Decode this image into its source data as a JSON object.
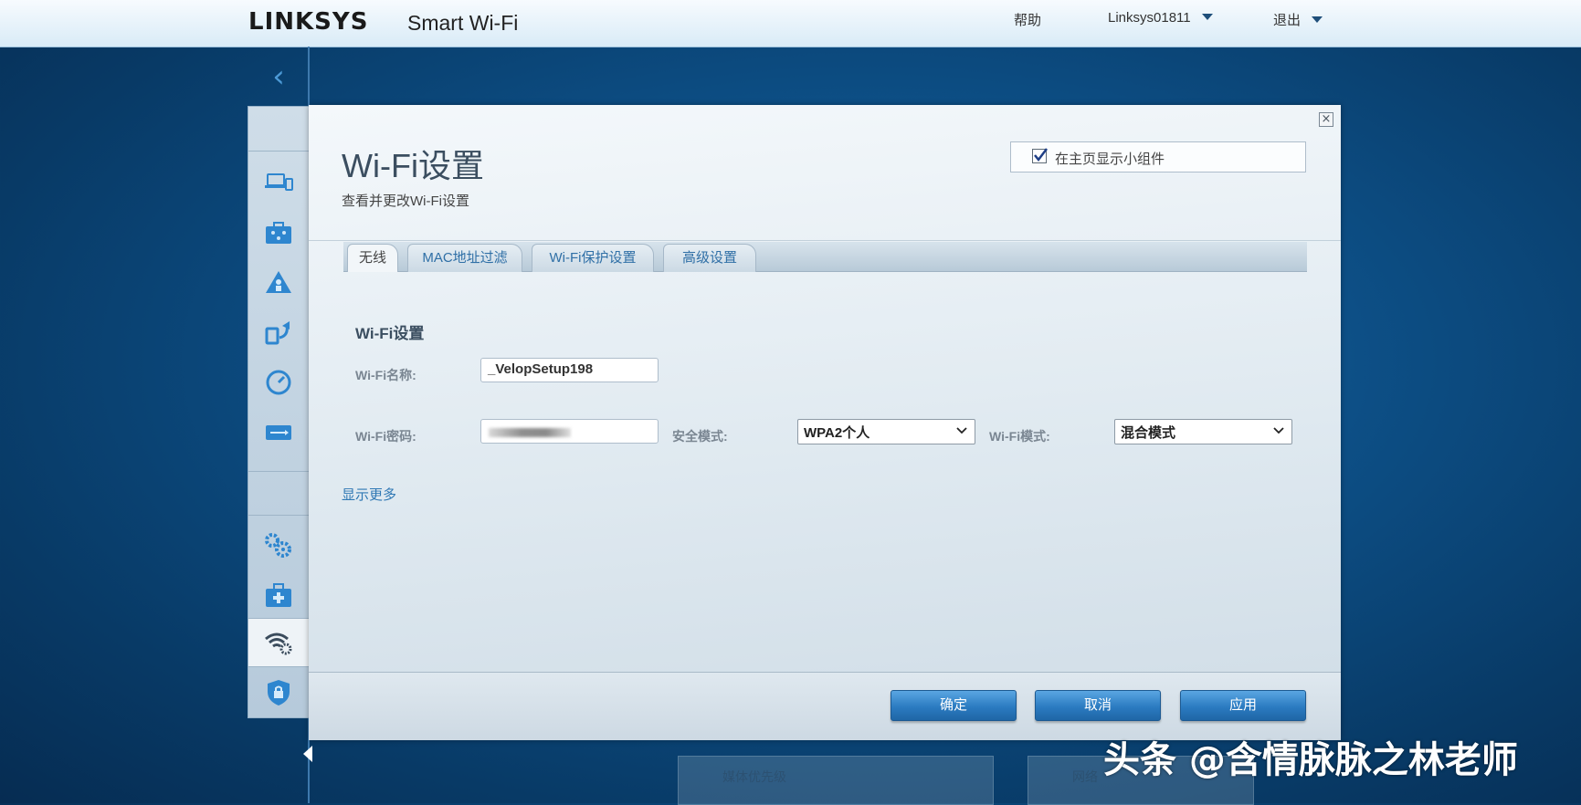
{
  "header": {
    "brand": "LINKSYS",
    "product": "Smart Wi-Fi",
    "help": "帮助",
    "account": "Linksys01811",
    "logout": "退出"
  },
  "sidebar": {
    "items": [
      {
        "icon": "devices-icon"
      },
      {
        "icon": "parental-controls-icon"
      },
      {
        "icon": "guest-access-icon"
      },
      {
        "icon": "prioritization-icon"
      },
      {
        "icon": "speed-test-icon"
      },
      {
        "icon": "external-storage-icon"
      },
      {
        "icon": "connectivity-settings-icon"
      },
      {
        "icon": "troubleshooting-icon"
      },
      {
        "icon": "wifi-settings-icon",
        "active": true
      },
      {
        "icon": "security-icon"
      }
    ]
  },
  "dialog": {
    "title": "Wi-Fi设置",
    "subtitle": "查看并更改Wi-Fi设置",
    "show_widget_label": "在主页显示小组件",
    "show_widget_checked": true,
    "tabs": [
      {
        "label": "无线",
        "active": true
      },
      {
        "label": "MAC地址过滤"
      },
      {
        "label": "Wi-Fi保护设置"
      },
      {
        "label": "高级设置"
      }
    ],
    "section_title": "Wi-Fi设置",
    "wifi_name_label": "Wi-Fi名称:",
    "wifi_name_value": "_VelopSetup198",
    "wifi_password_label": "Wi-Fi密码:",
    "security_mode_label": "安全模式:",
    "security_mode_value": "WPA2个人",
    "wifi_mode_label": "Wi-Fi模式:",
    "wifi_mode_value": "混合模式",
    "show_more": "显示更多",
    "buttons": {
      "ok": "确定",
      "cancel": "取消",
      "apply": "应用"
    }
  },
  "background_widgets": [
    {
      "label": "媒体优先级"
    },
    {
      "label": "网络"
    }
  ],
  "watermark": "头条 @含情脉脉之林老师",
  "colors": {
    "accent_blue": "#2b7bc1",
    "link_blue": "#2f78b4",
    "background_blue": "#0d4f86"
  }
}
